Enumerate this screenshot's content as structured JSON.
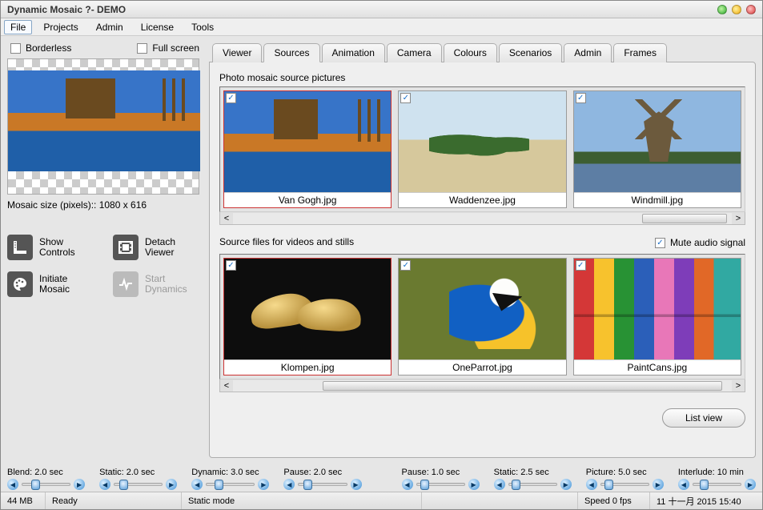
{
  "window": {
    "title": "Dynamic Mosaic ?- DEMO"
  },
  "menubar": {
    "file": "File",
    "projects": "Projects",
    "admin": "Admin",
    "license": "License",
    "tools": "Tools"
  },
  "left": {
    "borderless_label": "Borderless",
    "fullscreen_label": "Full screen",
    "mosaic_size_label": "Mosaic size (pixels):: 1080 x 616",
    "btn_show_controls_l1": "Show",
    "btn_show_controls_l2": "Controls",
    "btn_detach_viewer_l1": "Detach",
    "btn_detach_viewer_l2": "Viewer",
    "btn_initiate_mosaic_l1": "Initiate",
    "btn_initiate_mosaic_l2": "Mosaic",
    "btn_start_dynamics_l1": "Start",
    "btn_start_dynamics_l2": "Dynamics"
  },
  "tabs": {
    "viewer": "Viewer",
    "sources": "Sources",
    "animation": "Animation",
    "camera": "Camera",
    "colours": "Colours",
    "scenarios": "Scenarios",
    "admin": "Admin",
    "frames": "Frames"
  },
  "sources_panel": {
    "photo_label": "Photo mosaic source pictures",
    "photos": [
      {
        "caption": "Van Gogh.jpg",
        "checked": true,
        "selected": true
      },
      {
        "caption": "Waddenzee.jpg",
        "checked": true,
        "selected": false
      },
      {
        "caption": "Windmill.jpg",
        "checked": true,
        "selected": false
      }
    ],
    "video_label": "Source files for videos and stills",
    "mute_label": "Mute audio signal",
    "mute_checked": true,
    "videos": [
      {
        "caption": "Klompen.jpg",
        "checked": true,
        "selected": true
      },
      {
        "caption": "OneParrot.jpg",
        "checked": true,
        "selected": false
      },
      {
        "caption": "PaintCans.jpg",
        "checked": true,
        "selected": false
      }
    ],
    "list_view": "List view"
  },
  "sliders": {
    "blend": {
      "label": "Blend: 2.0 sec"
    },
    "static1": {
      "label": "Static: 2.0 sec"
    },
    "dynamic": {
      "label": "Dynamic: 3.0 sec"
    },
    "pause1": {
      "label": "Pause: 2.0 sec"
    },
    "pause2": {
      "label": "Pause: 1.0 sec"
    },
    "static2": {
      "label": "Static: 2.5 sec"
    },
    "picture": {
      "label": "Picture: 5.0 sec"
    },
    "interlude": {
      "label": "Interlude: 10 min"
    }
  },
  "statusbar": {
    "mem": "44 MB",
    "ready": "Ready",
    "mode": "Static mode",
    "speed": "Speed 0 fps",
    "datetime": "11 十一月 2015  15:40"
  }
}
